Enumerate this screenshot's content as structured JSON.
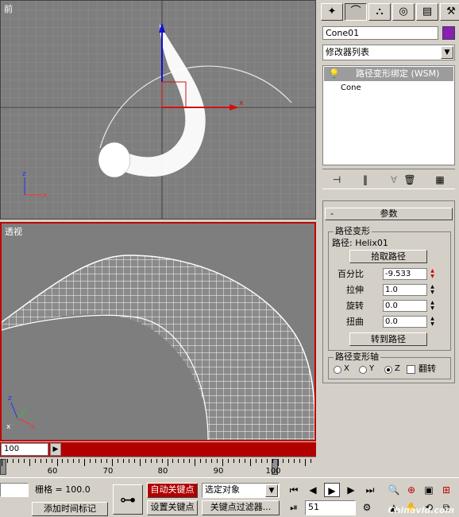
{
  "viewports": {
    "front_label": "前",
    "persp_label": "透视",
    "axis_x": "x",
    "axis_y": "y",
    "axis_z": "z"
  },
  "timeline": {
    "frame_field": "100",
    "arrow": "▶",
    "ticks": [
      "60",
      "70",
      "80",
      "90",
      "100"
    ]
  },
  "bottom_bar": {
    "grid_label": "栅格 = 100.0",
    "add_time_tag": "添加时间标记",
    "auto_key": "自动关键点",
    "set_key": "设置关键点",
    "selected_object": "选定对象",
    "key_filters": "关键点过滤器...",
    "current_frame": "51"
  },
  "command_panel": {
    "object_name": "Cone01",
    "object_color": "#8a1fb3",
    "modifier_list": "修改器列表",
    "stack_selected": "路径变形绑定 (WSM)",
    "stack_item": "Cone",
    "rollout_title": "参数",
    "group_path_deform": "路径变形",
    "path_label": "路径: Helix01",
    "pick_path": "拾取路径",
    "percent_label": "百分比",
    "percent_value": "-9.533",
    "stretch_label": "拉伸",
    "stretch_value": "1.0",
    "rotation_label": "旋转",
    "rotation_value": "0.0",
    "twist_label": "扭曲",
    "twist_value": "0.0",
    "move_to_path": "转到路径",
    "group_axis": "路径变形轴",
    "axis_x": "X",
    "axis_y": "Y",
    "axis_z": "Z",
    "flip": "翻转",
    "selected_axis": "Z"
  },
  "watermark": "Chinavid.com"
}
